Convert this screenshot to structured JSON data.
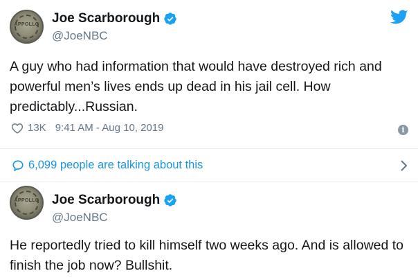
{
  "tweets": [
    {
      "author": {
        "display_name": "Joe Scarborough",
        "handle": "@JoeNBC",
        "avatar_text": "APPOLLO",
        "verified": true
      },
      "text": "A guy who had information that would have destroyed rich and powerful men’s lives ends up dead in his jail cell. How predictably...Russian.",
      "likes": "13K",
      "timestamp": "9:41 AM - Aug 10, 2019",
      "talking": "6,099 people are talking about this"
    },
    {
      "author": {
        "display_name": "Joe Scarborough",
        "handle": "@JoeNBC",
        "avatar_text": "APPOLLO",
        "verified": true
      },
      "text": "He reportedly tried to kill himself two weeks ago. And is allowed to finish the job now? Bullshit."
    }
  ],
  "icons": {
    "brand": "twitter-bird-icon",
    "verified": "verified-badge-icon",
    "like": "heart-icon",
    "info": "info-icon",
    "reply": "speech-bubble-icon",
    "more": "chevron-right-icon"
  },
  "colors": {
    "twitter_blue": "#1da1f2",
    "link_blue": "#1b95e0",
    "muted": "#657786",
    "text": "#14171a",
    "divider": "#e6ecf0"
  }
}
